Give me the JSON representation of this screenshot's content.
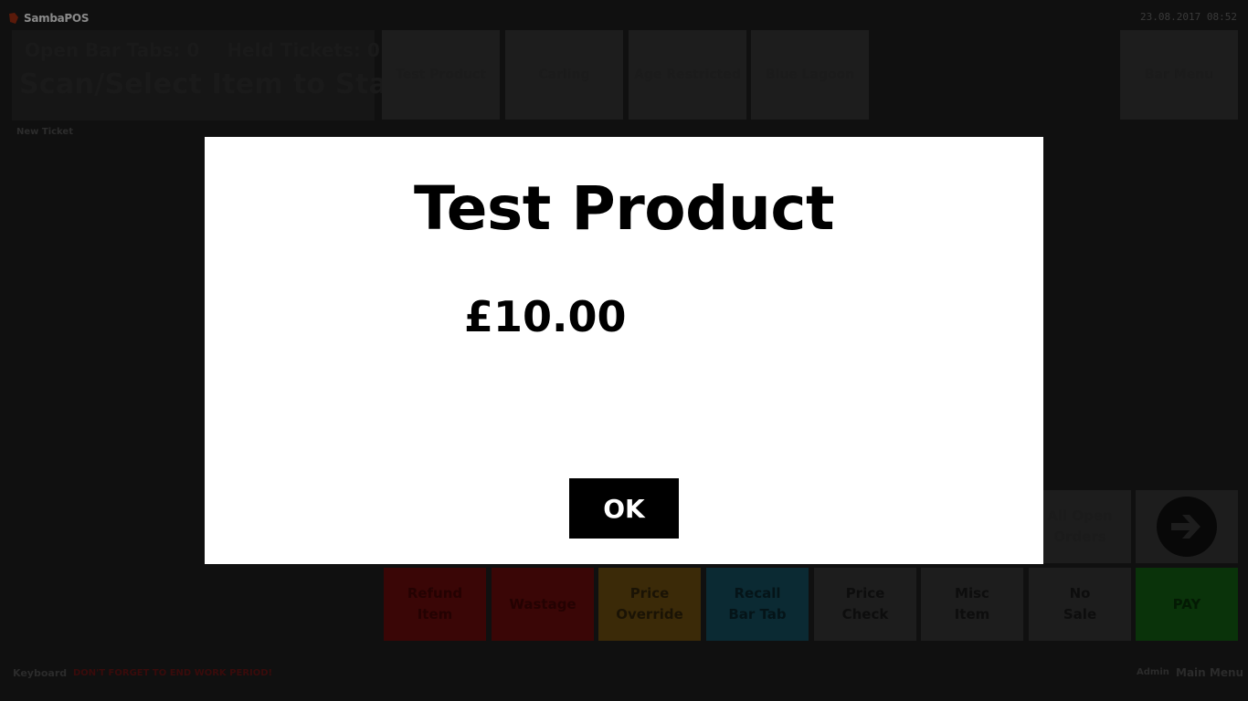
{
  "app": {
    "name": "SambaPOS",
    "datetime": "23.08.2017 08:52"
  },
  "status": {
    "open_bar_tabs": "Open Bar Tabs: 0",
    "held_tickets": "Held Tickets: 0",
    "prompt": "Scan/Select Item to Start"
  },
  "products": [
    {
      "label": "Test Product"
    },
    {
      "label": "Carling"
    },
    {
      "label": "Age Restricted"
    },
    {
      "label": "Blue Lagoon"
    }
  ],
  "bar_menu_label": "Bar Menu",
  "new_ticket_label": "New Ticket",
  "actions": {
    "all_open_orders": "All Open\nOrders",
    "refund_item": "Refund\nItem",
    "wastage": "Wastage",
    "price_override": "Price\nOverride",
    "recall_bar_tab": "Recall\nBar Tab",
    "price_check": "Price\nCheck",
    "misc_item": "Misc\nItem",
    "no_sale": "No\nSale",
    "pay": "PAY"
  },
  "footer": {
    "keyboard": "Keyboard",
    "warning": "DON'T FORGET TO END WORK PERIOD!",
    "user": "Admin",
    "main_menu": "Main Menu"
  },
  "dialog": {
    "title": "Test Product",
    "price": "£10.00",
    "ok_label": "OK"
  },
  "colors": {
    "refund": "#3a0606",
    "wastage": "#3a0606",
    "price_override": "#3b2a08",
    "recall": "#0b2a33",
    "neutral": "#1d1d1d",
    "pay": "#0a330a"
  }
}
